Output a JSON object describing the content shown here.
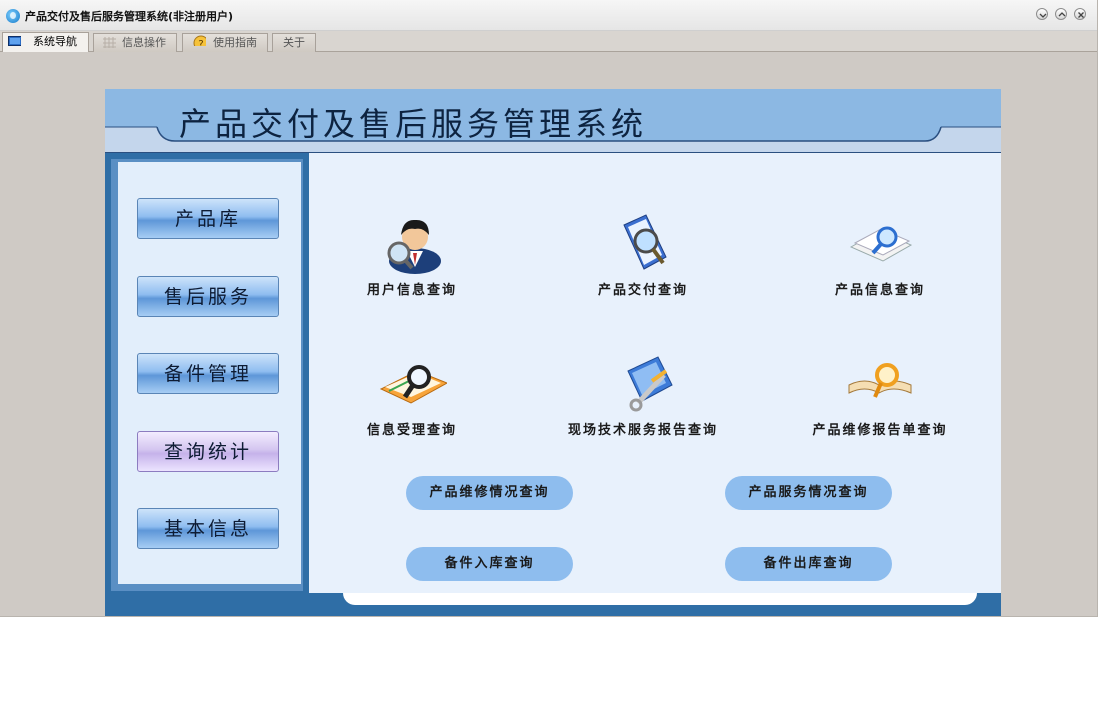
{
  "window": {
    "title": "产品交付及售后服务管理系统(非注册用户)"
  },
  "tabs": [
    {
      "label": "系统导航",
      "icon": "monitor-icon",
      "active": true
    },
    {
      "label": "信息操作",
      "icon": "grid-icon",
      "active": false
    },
    {
      "label": "使用指南",
      "icon": "help-icon",
      "active": false
    },
    {
      "label": "关于",
      "icon": "",
      "active": false
    }
  ],
  "header": {
    "title": "产品交付及售后服务管理系统"
  },
  "nav": [
    {
      "label": "产品库"
    },
    {
      "label": "售后服务"
    },
    {
      "label": "备件管理"
    },
    {
      "label": "查询统计",
      "selected": true
    },
    {
      "label": "基本信息"
    }
  ],
  "queries": [
    {
      "label": "用户信息查询",
      "icon": "user-search-icon"
    },
    {
      "label": "产品交付查询",
      "icon": "book-magnifier-icon"
    },
    {
      "label": "产品信息查询",
      "icon": "papers-magnifier-icon"
    },
    {
      "label": "信息受理查询",
      "icon": "notebook-magnifier-icon"
    },
    {
      "label": "现场技术服务报告查询",
      "icon": "tools-report-icon"
    },
    {
      "label": "产品维修报告单查询",
      "icon": "open-book-magnifier-icon"
    }
  ],
  "pills": [
    {
      "label": "产品维修情况查询"
    },
    {
      "label": "产品服务情况查询"
    },
    {
      "label": "备件入库查询"
    },
    {
      "label": "备件出库查询"
    }
  ],
  "colors": {
    "frame": "#2f6ea6",
    "header": "#8cb8e3",
    "nav_button": "#8fbdf0",
    "pill": "#8ebdee",
    "content_bg": "#e8f1fc"
  }
}
